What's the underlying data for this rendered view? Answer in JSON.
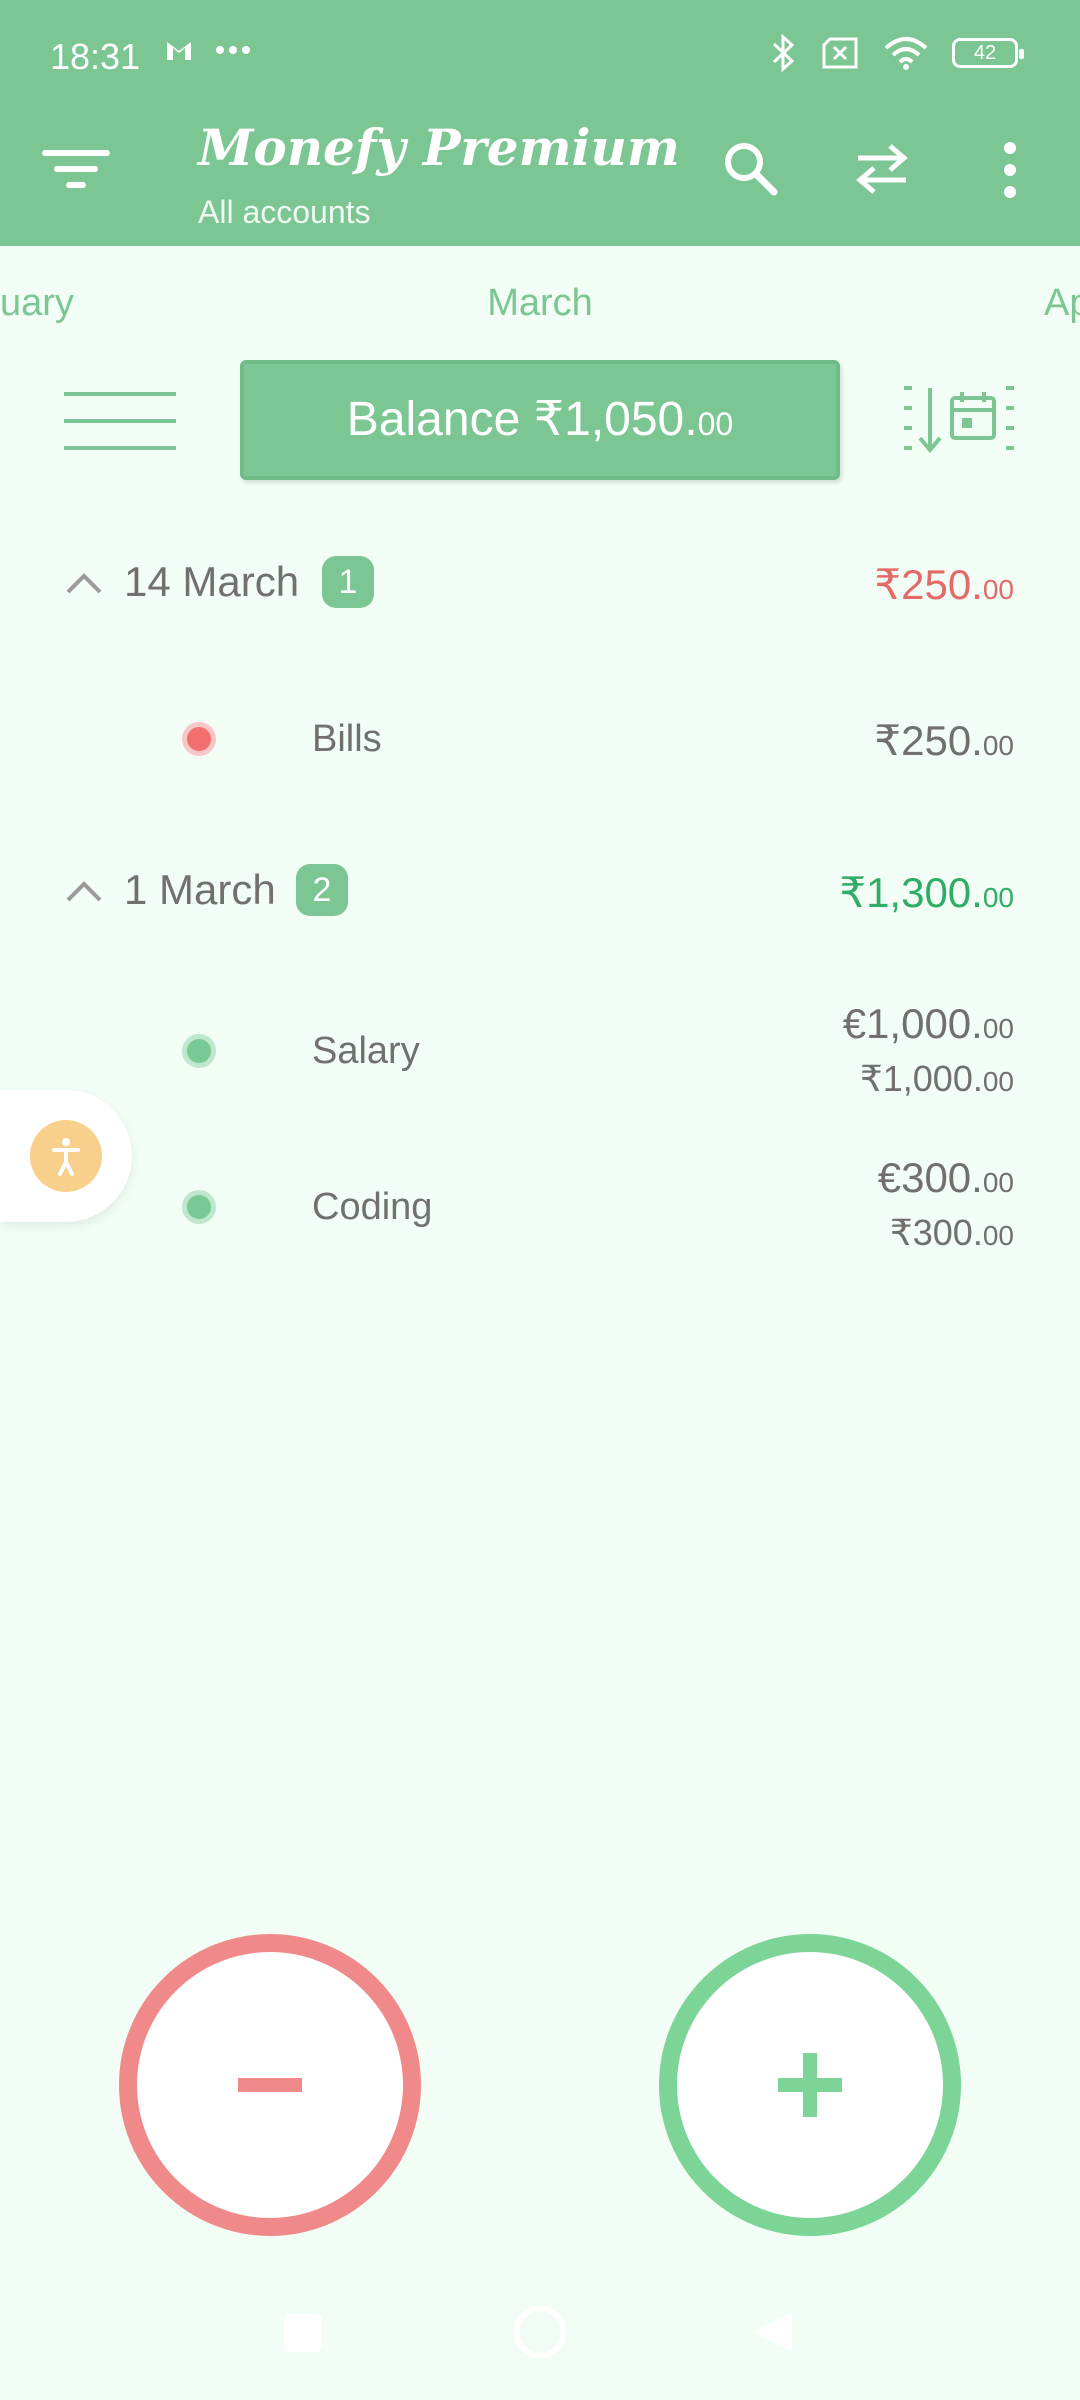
{
  "status_bar": {
    "time": "18:31",
    "battery": "42",
    "icons": [
      "gmail-icon",
      "more-notifications-icon",
      "bluetooth-icon",
      "no-sim-icon",
      "wifi-icon",
      "battery-icon"
    ]
  },
  "header": {
    "title": "Monefy Premium",
    "subtitle": "All accounts",
    "background_color": "#7cc693"
  },
  "months": {
    "previous": "uary",
    "current": "March",
    "next": "Ap"
  },
  "balance": {
    "label": "Balance ₹1,050.",
    "cents": "00"
  },
  "groups": [
    {
      "date": "14 March",
      "count": "1",
      "amount": "₹250.",
      "amount_cents": "00",
      "amount_color": "#e36a67",
      "transactions": [
        {
          "name": "Bills",
          "amount": "₹250.",
          "amount_cents": "00"
        }
      ]
    },
    {
      "date": "1 March",
      "count": "2",
      "amount": "₹1,300.",
      "amount_cents": "00",
      "amount_color": "#2fad68",
      "transactions": [
        {
          "name": "Salary",
          "amount": "€1,000.",
          "amount_cents": "00",
          "converted": "₹1,000.",
          "converted_cents": "00"
        },
        {
          "name": "Coding",
          "amount": "€300.",
          "amount_cents": "00",
          "converted": "₹300.",
          "converted_cents": "00"
        }
      ]
    }
  ],
  "colors": {
    "background": "#f1fdf5",
    "expense": "#f08a8a",
    "income": "#7cd497"
  }
}
